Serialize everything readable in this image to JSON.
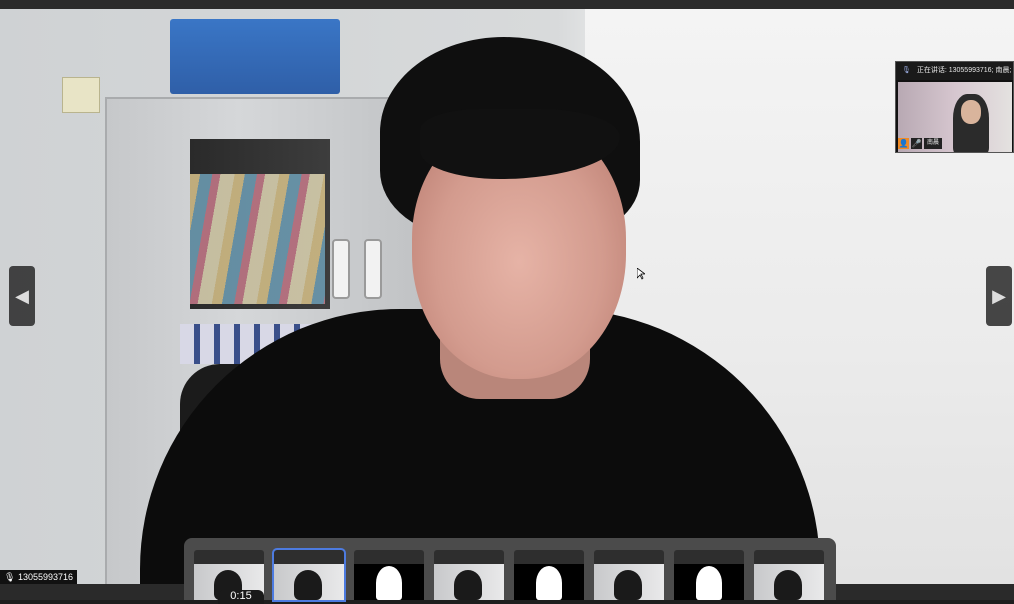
{
  "pip": {
    "header": "正在讲话: 13055993716; 南晨;",
    "participant_name": "南晨"
  },
  "caller_label": "13055993716",
  "timer": "0:15",
  "thumbnails": [
    {
      "type": "video"
    },
    {
      "type": "video",
      "active": true
    },
    {
      "type": "avatar"
    },
    {
      "type": "video"
    },
    {
      "type": "avatar"
    },
    {
      "type": "video"
    },
    {
      "type": "avatar"
    },
    {
      "type": "video"
    }
  ],
  "icons": {
    "prev": "chevron-left-icon",
    "next": "chevron-right-icon",
    "mic": "microphone-icon",
    "cursor": "mouse-pointer-icon"
  },
  "colors": {
    "active_outline": "#4d7be0",
    "pip_badge": "#f08a24"
  }
}
